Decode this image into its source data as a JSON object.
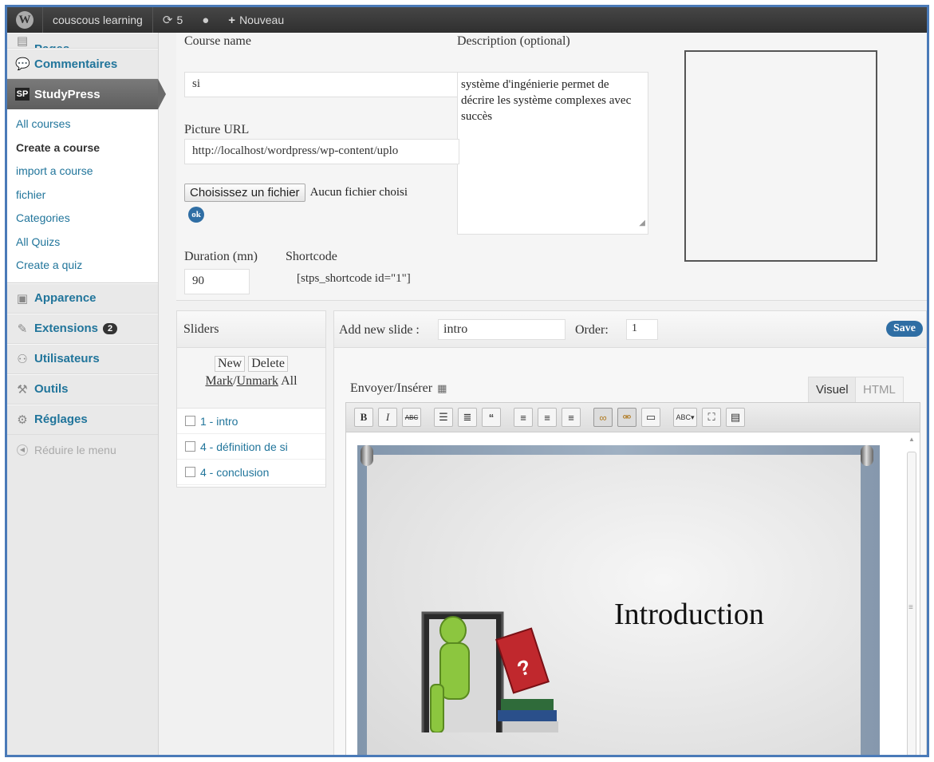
{
  "adminbar": {
    "site_name": "couscous learning",
    "updates_count": "5",
    "new_label": "Nouveau"
  },
  "menu": {
    "cut_item": "Pages",
    "comments": "Commentaires",
    "studypress": "StudyPress",
    "studypress_icon": "SP",
    "submenu": [
      "All courses",
      "Create a course",
      "import a course",
      "fichier",
      "Categories",
      "All Quizs",
      "Create a quiz"
    ],
    "appearance": "Apparence",
    "extensions": "Extensions",
    "extensions_badge": "2",
    "users": "Utilisateurs",
    "tools": "Outils",
    "settings": "Réglages",
    "collapse": "Réduire le menu"
  },
  "course_form": {
    "course_name_label": "Course name",
    "course_name_value": "si",
    "description_label": "Description (optional)",
    "description_value": "système d'ingénierie permet de décrire les système complexes avec succès",
    "picture_url_label": "Picture URL",
    "picture_url_value": "http://localhost/wordpress/wp-content/uplo",
    "file_button": "Choisissez un fichier",
    "file_status": "Aucun fichier choisi",
    "ok_label": "ok",
    "duration_label": "Duration (mn)",
    "duration_value": "90",
    "shortcode_label": "Shortcode",
    "shortcode_value": "[stps_shortcode id=\"1\"]"
  },
  "sliders": {
    "title": "Sliders",
    "new_label": "New",
    "delete_label": "Delete",
    "mark_label": "Mark",
    "unmark_label": "Unmark",
    "all_label": "All",
    "items": [
      "1 - intro",
      "4 - définition de si",
      "4 - conclusion"
    ]
  },
  "editor": {
    "add_slide_label": "Add new slide :",
    "add_slide_value": "intro",
    "order_label": "Order:",
    "order_value": "1",
    "save_label": "Save",
    "media_label": "Envoyer/Insérer",
    "tab_visual": "Visuel",
    "tab_html": "HTML",
    "toolbar": [
      "bold-icon",
      "italic-icon",
      "strikethrough-icon",
      "bullet-list-icon",
      "numbered-list-icon",
      "blockquote-icon",
      "align-left-icon",
      "align-center-icon",
      "align-right-icon",
      "link-icon",
      "unlink-icon",
      "more-tag-icon",
      "spellcheck-icon",
      "fullscreen-icon",
      "kitchen-sink-icon"
    ],
    "slide_title": "Introduction"
  },
  "colors": {
    "link_blue": "#21759b",
    "button_blue": "#2f6ea4",
    "adminbar_bg": "#383838",
    "frame_border": "#4a7ab8"
  }
}
